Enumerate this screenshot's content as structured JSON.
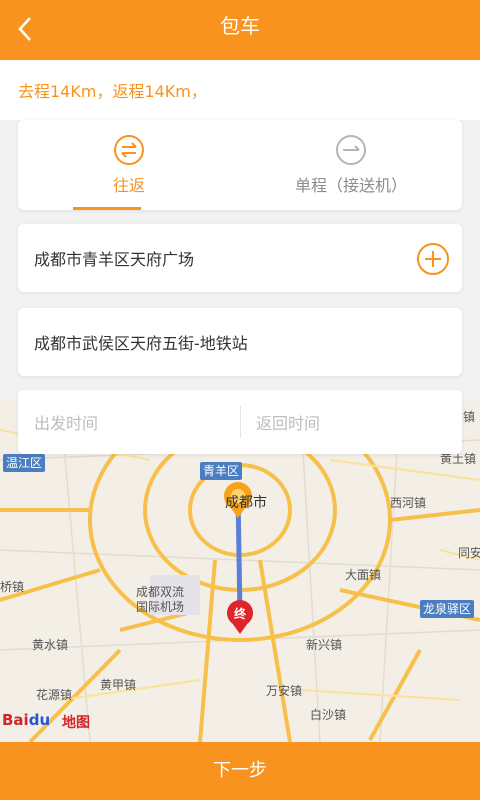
{
  "header": {
    "title": "包车",
    "back_icon": "chevron-left-icon"
  },
  "route": {
    "summary": "去程14Km，返程14Km，"
  },
  "tabs": [
    {
      "label": "往返",
      "icon": "round-trip-icon",
      "active": true
    },
    {
      "label": "单程（接送机）",
      "icon": "one-way-arrow-icon",
      "active": false
    }
  ],
  "locations": {
    "start": "成都市青羊区天府广场",
    "end": "成都市武侯区天府五街-地铁站",
    "add_icon": "plus-circle-icon"
  },
  "time": {
    "depart_placeholder": "出发时间",
    "return_placeholder": "返回时间"
  },
  "map": {
    "labels": {
      "wenjiang": "温江区",
      "qingyang": "青羊区",
      "chengdu": "成都市",
      "zhen_top": "镇",
      "huangtu": "黄土镇",
      "xihe": "西河镇",
      "tongan": "同安",
      "damian": "大面镇",
      "airport1": "成都双流",
      "airport2": "国际机场",
      "qiao": "桥镇",
      "longquanyi": "龙泉驿区",
      "huangshui": "黄水镇",
      "xinxing": "新兴镇",
      "huangjia": "黄甲镇",
      "huayuan": "花源镇",
      "wanan": "万安镇",
      "baisha": "白沙镇"
    },
    "end_marker": "终",
    "brand": {
      "bai": "Bai",
      "du": "du",
      "map_text": "地图"
    },
    "colors": {
      "road": "#f7c04a",
      "route": "#5b7fd6",
      "marker": "#f7a21a",
      "end": "#e0242b"
    }
  },
  "footer": {
    "next_label": "下一步"
  },
  "colors": {
    "accent": "#f7931e"
  }
}
